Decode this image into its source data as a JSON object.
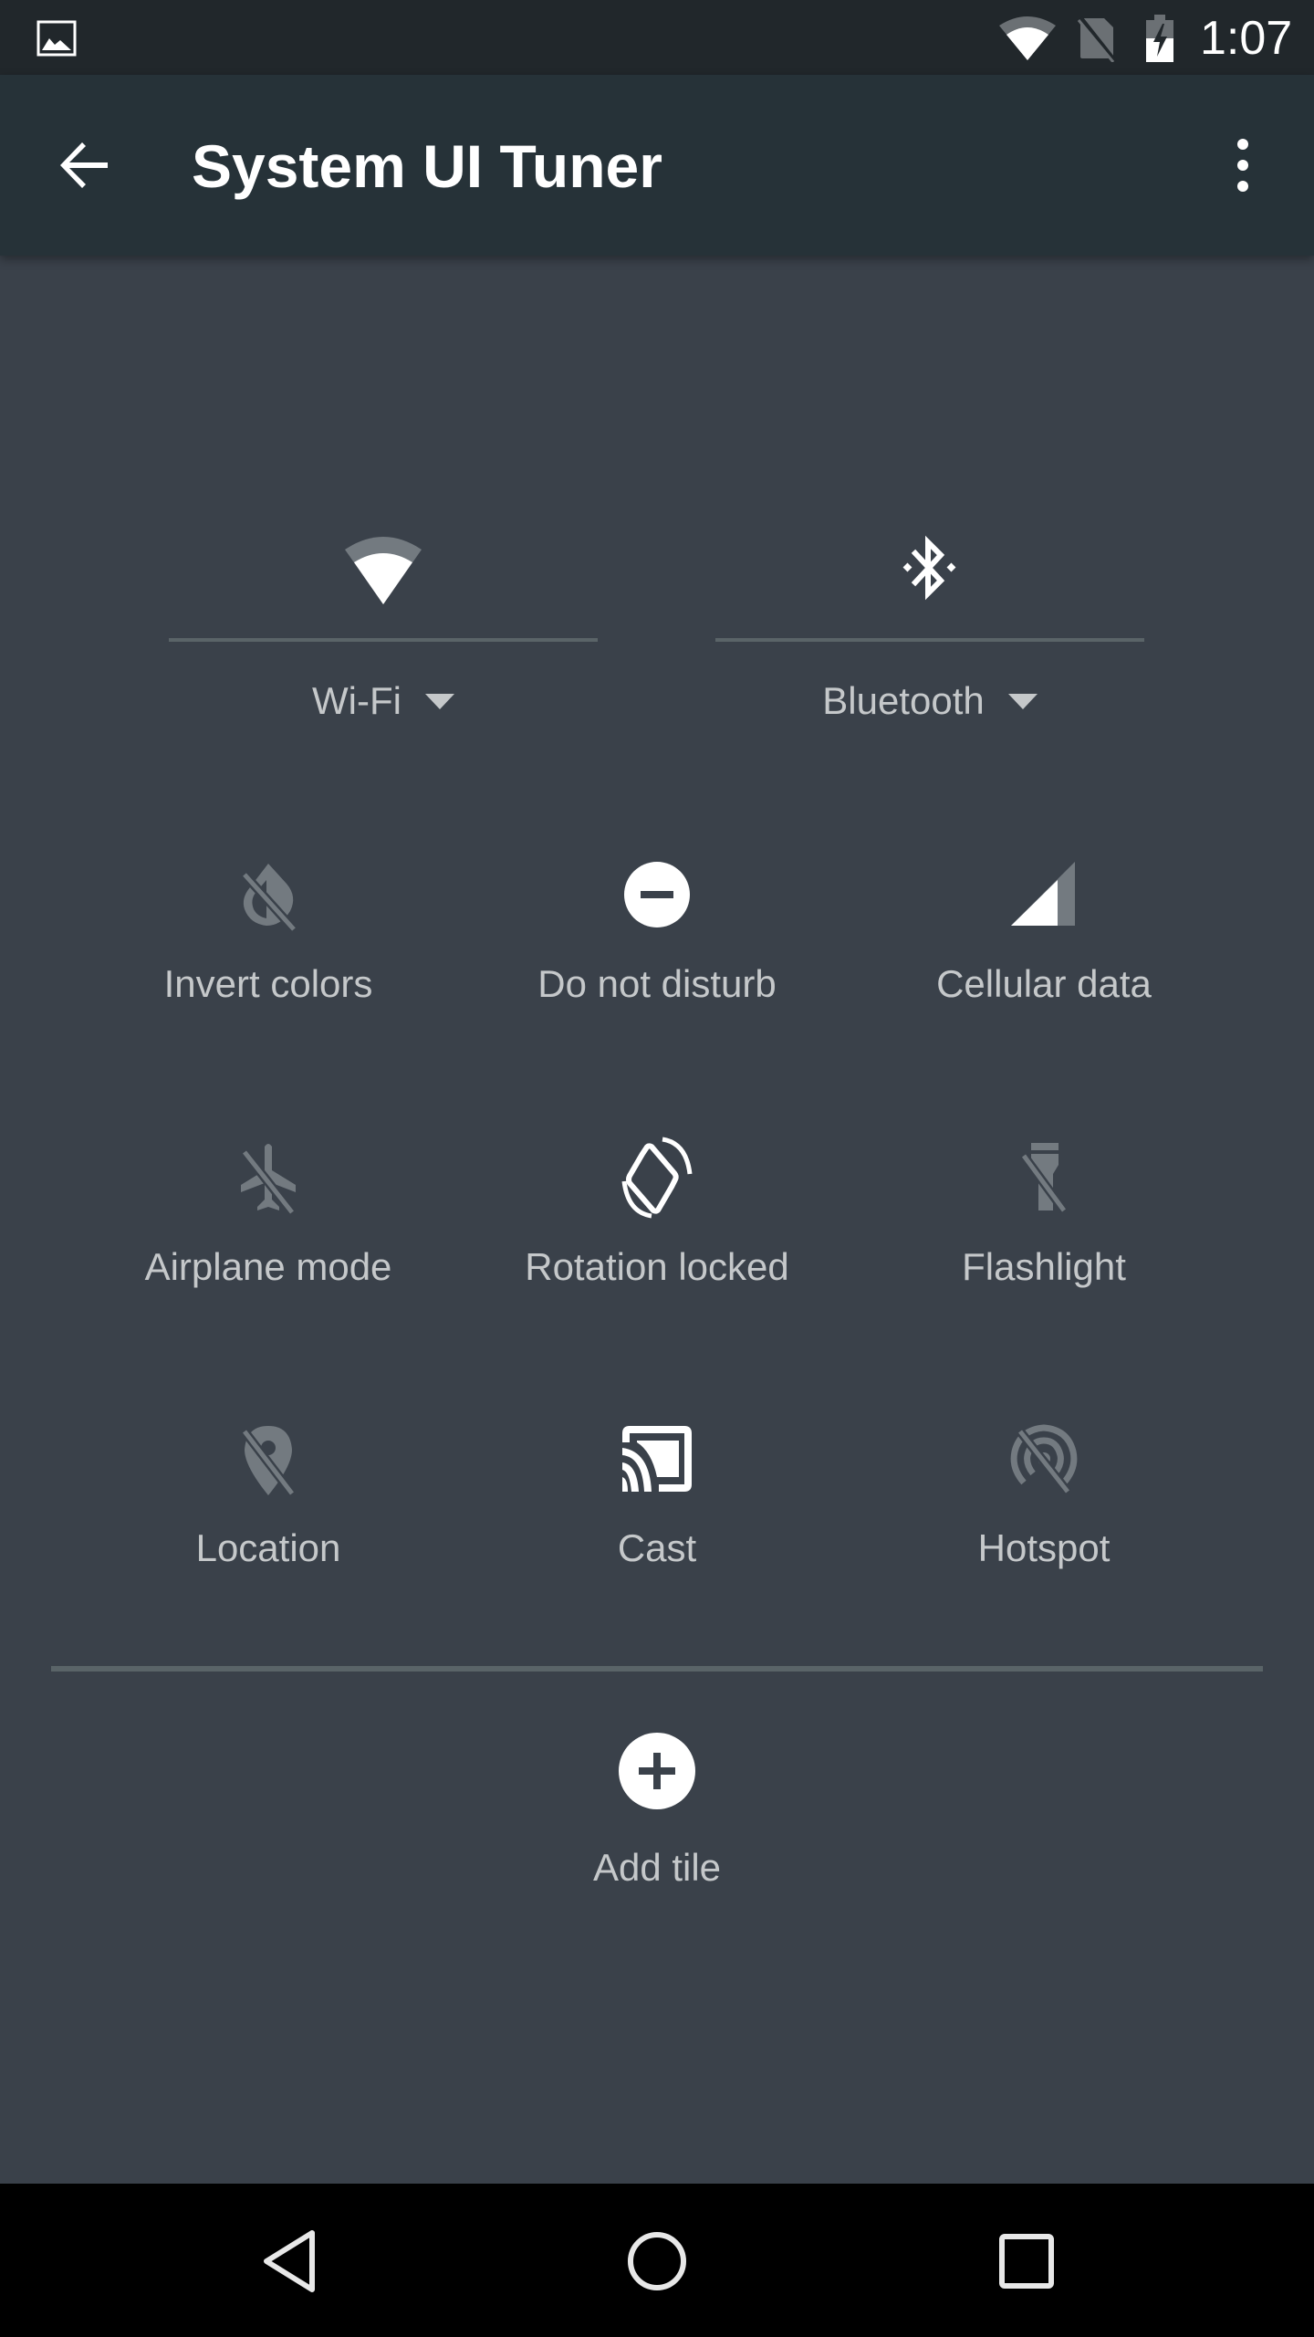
{
  "status_bar": {
    "notification_icon": "image-icon",
    "wifi_icon": "wifi-signal-icon",
    "sim_icon": "no-sim-icon",
    "battery_icon": "battery-charging-icon",
    "time": "1:07"
  },
  "toolbar": {
    "back_icon": "arrow-back-icon",
    "title": "System UI Tuner",
    "overflow_icon": "more-vert-icon"
  },
  "colors": {
    "status_bar_bg": "#21272b",
    "toolbar_bg": "#263238",
    "content_bg": "#3a414a",
    "active_icon": "#ffffff",
    "inactive_icon": "#737a80",
    "label_text": "#c5c8ca",
    "divider": "#5a6468",
    "nav_bar_bg": "#000000"
  },
  "big_tiles": [
    {
      "id": "wifi",
      "label": "Wi-Fi",
      "icon": "wifi-icon",
      "active": true,
      "has_dropdown": true
    },
    {
      "id": "bluetooth",
      "label": "Bluetooth",
      "icon": "bluetooth-icon",
      "active": true,
      "has_dropdown": true
    }
  ],
  "tiles": [
    {
      "id": "invert",
      "label": "Invert colors",
      "icon": "invert-colors-off-icon",
      "active": false
    },
    {
      "id": "dnd",
      "label": "Do not disturb",
      "icon": "do-not-disturb-icon",
      "active": true
    },
    {
      "id": "cellular",
      "label": "Cellular data",
      "icon": "cellular-signal-icon",
      "active": true
    },
    {
      "id": "airplane",
      "label": "Airplane mode",
      "icon": "airplane-off-icon",
      "active": false
    },
    {
      "id": "rotation",
      "label": "Rotation locked",
      "icon": "screen-rotation-icon",
      "active": true
    },
    {
      "id": "flashlight",
      "label": "Flashlight",
      "icon": "flashlight-off-icon",
      "active": false
    },
    {
      "id": "location",
      "label": "Location",
      "icon": "location-off-icon",
      "active": false
    },
    {
      "id": "cast",
      "label": "Cast",
      "icon": "cast-icon",
      "active": true
    },
    {
      "id": "hotspot",
      "label": "Hotspot",
      "icon": "hotspot-off-icon",
      "active": false
    }
  ],
  "add_tile": {
    "label": "Add tile",
    "icon": "add-circle-icon"
  },
  "nav_bar": {
    "back_icon": "nav-back-icon",
    "home_icon": "nav-home-icon",
    "recents_icon": "nav-recents-icon"
  }
}
